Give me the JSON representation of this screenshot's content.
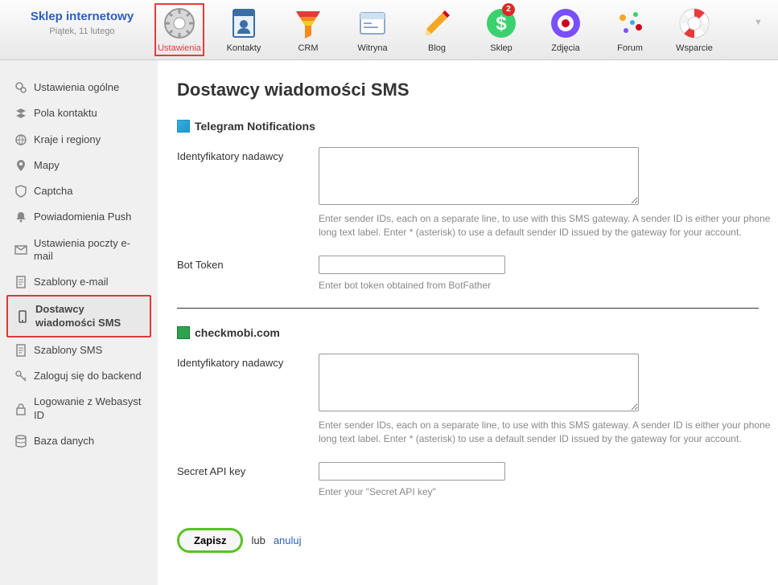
{
  "brand": {
    "title": "Sklep internetowy",
    "date": "Piątek, 11 lutego"
  },
  "apps": [
    {
      "label": "Ustawienia",
      "icon": "gear",
      "active": true
    },
    {
      "label": "Kontakty",
      "icon": "contact"
    },
    {
      "label": "CRM",
      "icon": "funnel"
    },
    {
      "label": "Witryna",
      "icon": "window"
    },
    {
      "label": "Blog",
      "icon": "pencil"
    },
    {
      "label": "Sklep",
      "icon": "dollar",
      "badge": "2"
    },
    {
      "label": "Zdjęcia",
      "icon": "ball"
    },
    {
      "label": "Forum",
      "icon": "confetti"
    },
    {
      "label": "Wsparcie",
      "icon": "lifebuoy"
    }
  ],
  "sidebar": [
    {
      "label": "Ustawienia ogólne",
      "icon": "gears"
    },
    {
      "label": "Pola kontaktu",
      "icon": "layers"
    },
    {
      "label": "Kraje i regiony",
      "icon": "globe"
    },
    {
      "label": "Mapy",
      "icon": "pin"
    },
    {
      "label": "Captcha",
      "icon": "shield"
    },
    {
      "label": "Powiadomienia Push",
      "icon": "bell"
    },
    {
      "label": "Ustawienia poczty e-mail",
      "icon": "mail"
    },
    {
      "label": "Szablony e-mail",
      "icon": "doc"
    },
    {
      "label": "Dostawcy wiadomości SMS",
      "icon": "phone",
      "active": true
    },
    {
      "label": "Szablony SMS",
      "icon": "doc"
    },
    {
      "label": "Zaloguj się do backend",
      "icon": "key"
    },
    {
      "label": "Logowanie z Webasyst ID",
      "icon": "lock"
    },
    {
      "label": "Baza danych",
      "icon": "db"
    }
  ],
  "page": {
    "title": "Dostawcy wiadomości SMS",
    "sec1": "Telegram Notifications",
    "sec2": "checkmobi.com",
    "lbl_sender": "Identyfikatory nadawcy",
    "hint_sender": "Enter sender IDs, each on a separate line, to use with this SMS gateway. A sender ID is either your phone long text label. Enter * (asterisk) to use a default sender ID issued by the gateway for your account.",
    "lbl_bot": "Bot Token",
    "hint_bot": "Enter bot token obtained from BotFather",
    "lbl_secret": "Secret API key",
    "hint_secret": "Enter your \"Secret API key\"",
    "save": "Zapisz",
    "or": "lub",
    "cancel": "anuluj"
  }
}
